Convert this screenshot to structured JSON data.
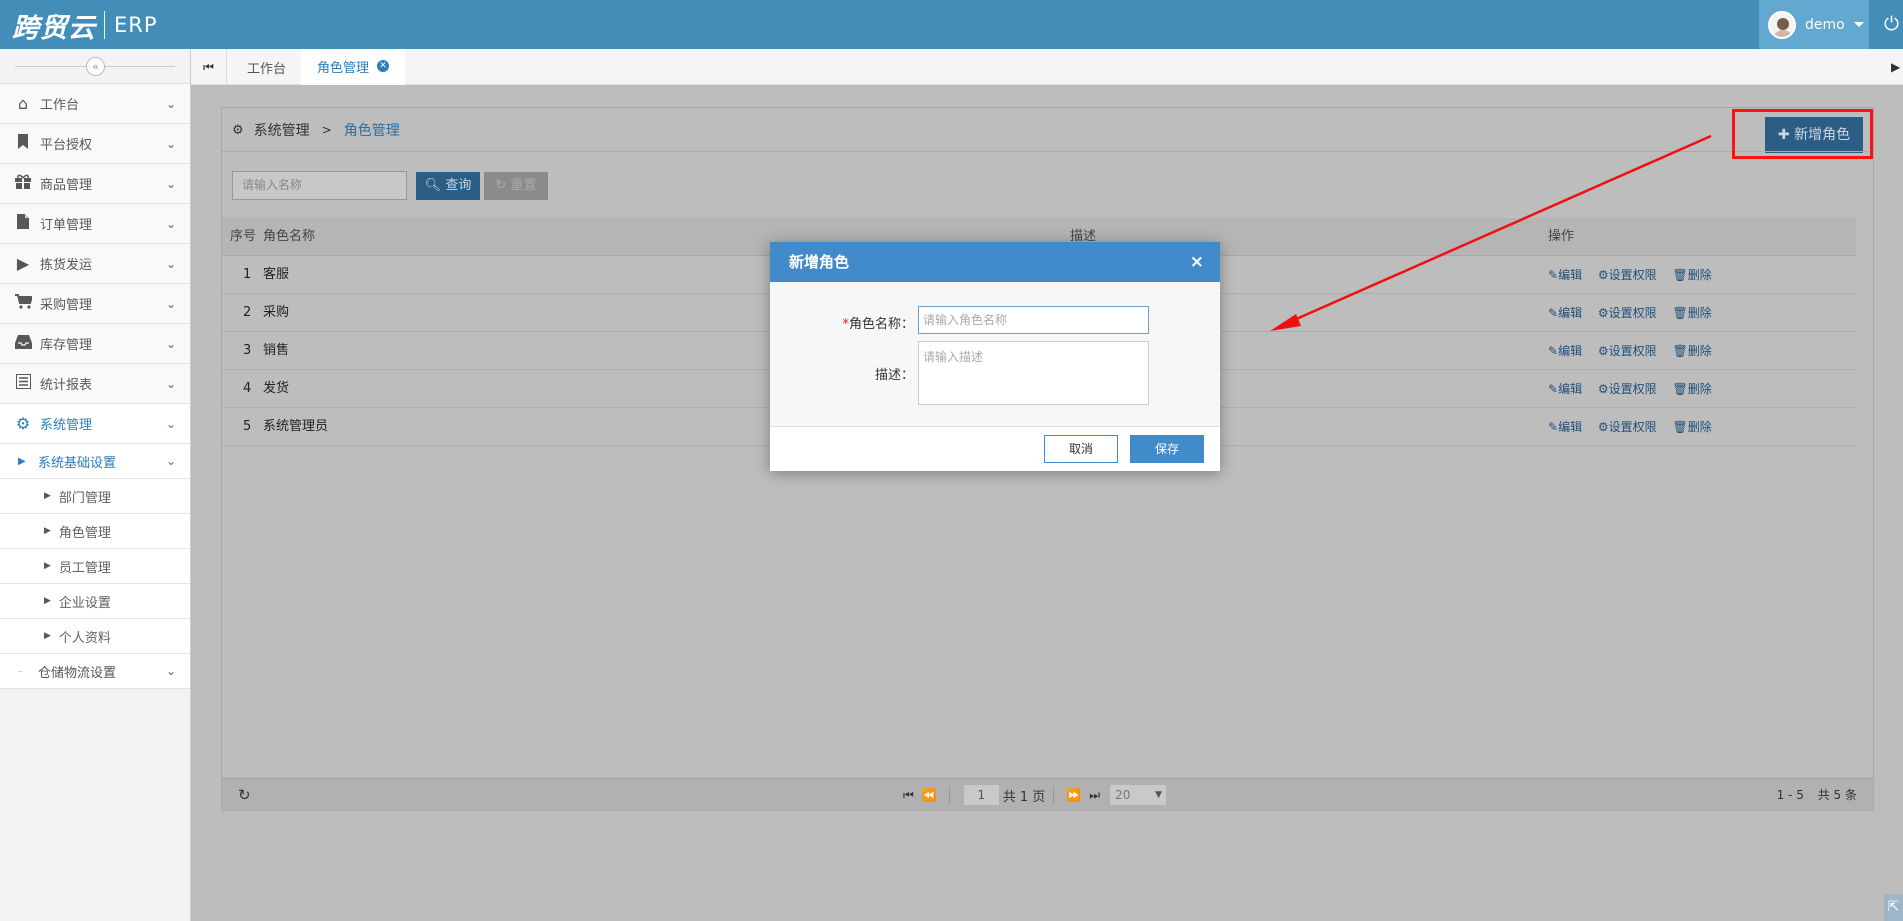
{
  "header": {
    "logo_main": "跨贸云",
    "logo_sub": "ERP",
    "user_name": "demo",
    "colors": {
      "primary": "#438eb9",
      "user_box": "#62a8d1"
    }
  },
  "sidebar": {
    "collapse_icon": "«",
    "items": [
      {
        "label": "工作台",
        "icon": "home-icon"
      },
      {
        "label": "平台授权",
        "icon": "bookmark-icon"
      },
      {
        "label": "商品管理",
        "icon": "gift-icon"
      },
      {
        "label": "订单管理",
        "icon": "file-icon"
      },
      {
        "label": "拣货发运",
        "icon": "caret-right-icon"
      },
      {
        "label": "采购管理",
        "icon": "cart-icon"
      },
      {
        "label": "库存管理",
        "icon": "inbox-icon"
      },
      {
        "label": "统计报表",
        "icon": "list-icon"
      },
      {
        "label": "系统管理",
        "icon": "cog-icon"
      }
    ],
    "sub_group": "系统基础设置",
    "sub_items": [
      "部门管理",
      "角色管理",
      "员工管理",
      "企业设置",
      "个人资料"
    ],
    "sub_group_2": "仓储物流设置"
  },
  "tabs": [
    {
      "label": "工作台"
    },
    {
      "label": "角色管理"
    }
  ],
  "breadcrumb": {
    "root": "系统管理",
    "separator": ">",
    "current": "角色管理"
  },
  "toolbar": {
    "add_label": "新增角色",
    "search_placeholder": "请输入名称",
    "query_label": "查询",
    "reset_label": "重置"
  },
  "table": {
    "columns": [
      "序号",
      "角色名称",
      "描述",
      "操作"
    ],
    "rows": [
      {
        "no": "1",
        "name": "客服"
      },
      {
        "no": "2",
        "name": "采购"
      },
      {
        "no": "3",
        "name": "销售"
      },
      {
        "no": "4",
        "name": "发货"
      },
      {
        "no": "5",
        "name": "系统管理员"
      }
    ],
    "actions": {
      "edit": "编辑",
      "perm": "设置权限",
      "delete": "删除"
    }
  },
  "pagination": {
    "page": "1",
    "total_pages": "共 1 页",
    "page_size": "20",
    "range": "1 - 5",
    "total": "共 5 条"
  },
  "modal": {
    "title": "新增角色",
    "close": "×",
    "name_label": "角色名称：",
    "name_required": "*",
    "name_placeholder": "请输入角色名称",
    "desc_label": "描述：",
    "desc_placeholder": "请输入描述",
    "cancel_label": "取消",
    "save_label": "保存"
  }
}
